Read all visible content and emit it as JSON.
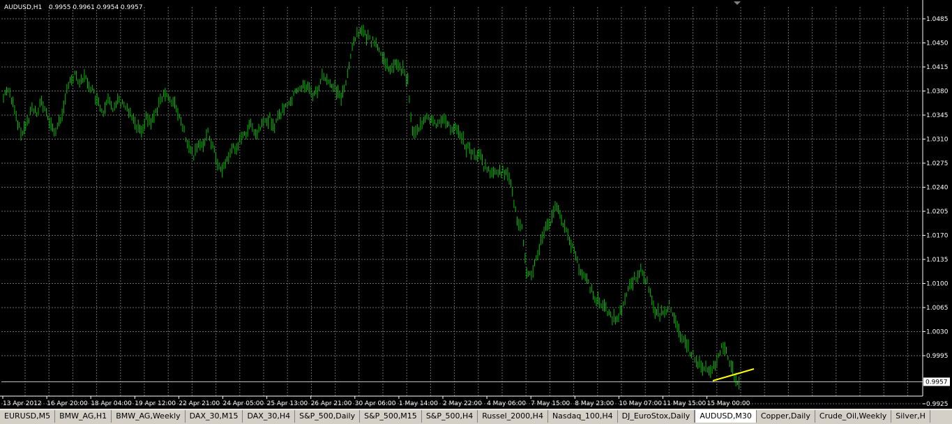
{
  "chart": {
    "symbol_label": "AUDUSD,H1",
    "ohlc_label": "0.9955 0.9961 0.9954 0.9957",
    "current_price_label": "0.9957",
    "colors": {
      "background": "#000000",
      "grid": "#6b6b6b",
      "bars": "#00c000",
      "text": "#ffffff",
      "trendline": "#ffff00",
      "bid_line": "#c0c0c0"
    }
  },
  "chart_data": {
    "type": "line",
    "title": "AUDUSD,H1",
    "y_ticks": [
      "1.0485",
      "1.0450",
      "1.0415",
      "1.0380",
      "1.0345",
      "1.0310",
      "1.0275",
      "1.0240",
      "1.0205",
      "1.0170",
      "1.0135",
      "1.0100",
      "1.0065",
      "1.0030",
      "0.9995",
      "0.9957",
      "0.9925"
    ],
    "x_ticks": [
      "13 Apr 2012",
      "16 Apr 20:00",
      "18 Apr 04:00",
      "19 Apr 12:00",
      "22 Apr 21:00",
      "24 Apr 05:00",
      "25 Apr 13:00",
      "26 Apr 21:00",
      "30 Apr 06:00",
      "1 May 14:00",
      "2 May 22:00",
      "4 May 06:00",
      "7 May 15:00",
      "8 May 23:00",
      "10 May 07:00",
      "11 May 15:00",
      "15 May 00:00"
    ],
    "ylim": [
      0.9925,
      1.0485
    ],
    "series": [
      {
        "values": [
          1.037,
          1.0385,
          1.036,
          1.033,
          1.0318,
          1.0335,
          1.0355,
          1.035,
          1.0365,
          1.0345,
          1.033,
          1.032,
          1.034,
          1.037,
          1.0395,
          1.0405,
          1.0395,
          1.04,
          1.039,
          1.0375,
          1.036,
          1.0345,
          1.0365,
          1.0355,
          1.037,
          1.036,
          1.0355,
          1.0345,
          1.033,
          1.0325,
          1.034,
          1.0335,
          1.035,
          1.0365,
          1.0375,
          1.037,
          1.036,
          1.034,
          1.032,
          1.0295,
          1.0285,
          1.03,
          1.0305,
          1.032,
          1.03,
          1.0275,
          1.0265,
          1.028,
          1.0295,
          1.03,
          1.031,
          1.032,
          1.033,
          1.0315,
          1.0325,
          1.0335,
          1.034,
          1.033,
          1.0345,
          1.0355,
          1.036,
          1.0375,
          1.038,
          1.039,
          1.0385,
          1.0375,
          1.038,
          1.04,
          1.0395,
          1.039,
          1.038,
          1.037,
          1.0395,
          1.043,
          1.046,
          1.047,
          1.046,
          1.0455,
          1.045,
          1.044,
          1.0425,
          1.041,
          1.042,
          1.0415,
          1.041,
          1.0395,
          1.032,
          1.0325,
          1.033,
          1.034,
          1.0335,
          1.033,
          1.034,
          1.0335,
          1.0325,
          1.033,
          1.032,
          1.03,
          1.0295,
          1.0285,
          1.029,
          1.027,
          1.0265,
          1.026,
          1.0258,
          1.0265,
          1.0255,
          1.0235,
          1.019,
          1.0185,
          1.012,
          1.011,
          1.0135,
          1.016,
          1.018,
          1.019,
          1.021,
          1.0205,
          1.018,
          1.016,
          1.015,
          1.012,
          1.011,
          1.01,
          1.0085,
          1.0075,
          1.007,
          1.006,
          1.005,
          1.0045,
          1.0065,
          1.0085,
          1.01,
          1.011,
          1.012,
          1.0105,
          1.009,
          1.006,
          1.0055,
          1.006,
          1.007,
          1.0045,
          1.003,
          1.002,
          1.0005,
          0.9995,
          0.9985,
          0.998,
          0.9975,
          0.997,
          0.999,
          1.0005,
          1.0,
          0.998,
          0.996,
          0.9957
        ]
      }
    ]
  },
  "tabs": [
    {
      "label": "EURUSD,M5",
      "active": false
    },
    {
      "label": "BMW_AG,H1",
      "active": false
    },
    {
      "label": "BMW_AG,Weekly",
      "active": false
    },
    {
      "label": "DAX_30,M15",
      "active": false
    },
    {
      "label": "DAX_30,H4",
      "active": false
    },
    {
      "label": "S&P_500,Daily",
      "active": false
    },
    {
      "label": "S&P_500,M15",
      "active": false
    },
    {
      "label": "S&P_500,H4",
      "active": false
    },
    {
      "label": "Russel_2000,H4",
      "active": false
    },
    {
      "label": "Nasdaq_100,H4",
      "active": false
    },
    {
      "label": "DJ_EuroStox,Daily",
      "active": false
    },
    {
      "label": "AUDUSD,M30",
      "active": true
    },
    {
      "label": "Copper,Daily",
      "active": false
    },
    {
      "label": "Crude_Oil,Weekly",
      "active": false
    },
    {
      "label": "Silver,H",
      "active": false
    }
  ]
}
